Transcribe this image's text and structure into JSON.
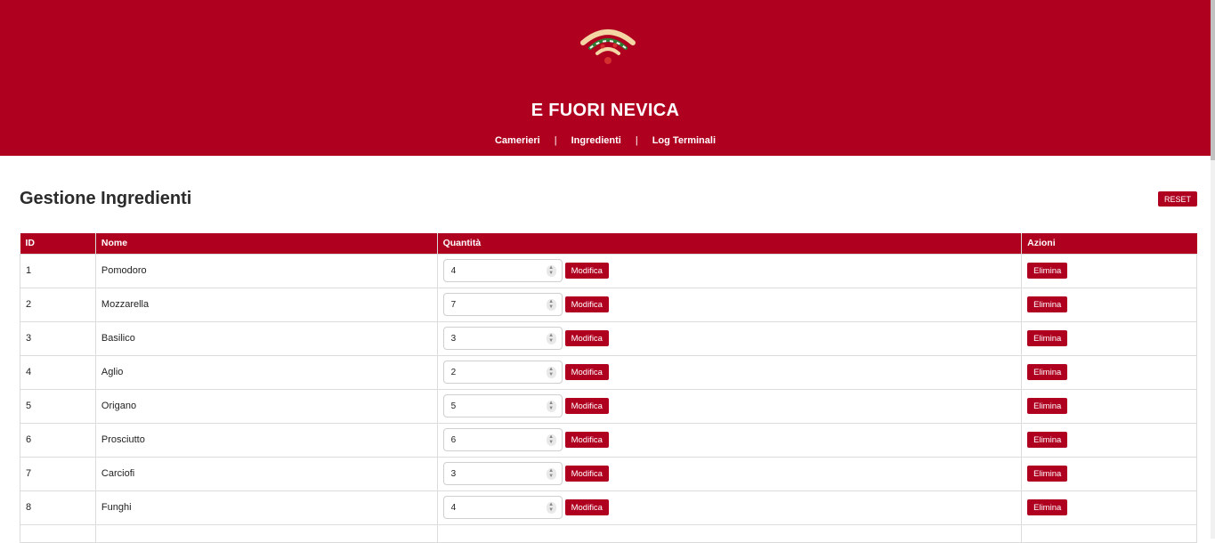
{
  "header": {
    "brand": "E FUORI NEVICA",
    "logo_icon": "pizza-wifi-logo-icon",
    "nav": [
      {
        "label": "Camerieri"
      },
      {
        "label": "Ingredienti"
      },
      {
        "label": "Log Terminali"
      }
    ],
    "nav_separator": "|"
  },
  "main": {
    "title": "Gestione Ingredienti",
    "reset_label": "RESET",
    "table": {
      "columns": [
        "ID",
        "Nome",
        "Quantità",
        "Azioni"
      ],
      "rows": [
        {
          "id": "1",
          "name": "Pomodoro",
          "qty": "4"
        },
        {
          "id": "2",
          "name": "Mozzarella",
          "qty": "7"
        },
        {
          "id": "3",
          "name": "Basilico",
          "qty": "3"
        },
        {
          "id": "4",
          "name": "Aglio",
          "qty": "2"
        },
        {
          "id": "5",
          "name": "Origano",
          "qty": "5"
        },
        {
          "id": "6",
          "name": "Prosciutto",
          "qty": "6"
        },
        {
          "id": "7",
          "name": "Carciofi",
          "qty": "3"
        },
        {
          "id": "8",
          "name": "Funghi",
          "qty": "4"
        }
      ],
      "modify_label": "Modifica",
      "delete_label": "Elimina"
    }
  },
  "colors": {
    "accent": "#b00020",
    "background": "#ffffff"
  }
}
